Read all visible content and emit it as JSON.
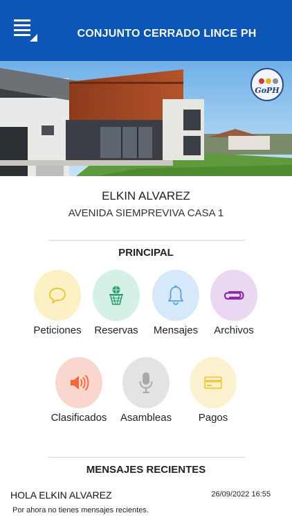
{
  "appbar": {
    "title": "CONJUNTO CERRADO LINCE PH",
    "color": "#0a55b5",
    "menu_icon": "menu-icon"
  },
  "hero": {
    "logo_text": "GoPH"
  },
  "user": {
    "name": "ELKIN ALVAREZ",
    "address": "AVENIDA SIEMPREVIVA CASA 1"
  },
  "principal": {
    "title": "PRINCIPAL",
    "tiles": [
      {
        "label": "Peticiones",
        "icon": "chat-bubble-icon",
        "bg": "#fbf1c4",
        "fg": "#e8c22a"
      },
      {
        "label": "Reservas",
        "icon": "basketball-hoop-icon",
        "bg": "#d5f0e4",
        "fg": "#2e9d6e"
      },
      {
        "label": "Mensajes",
        "icon": "bell-icon",
        "bg": "#d6e9fa",
        "fg": "#5f9fe0"
      },
      {
        "label": "Archivos",
        "icon": "paperclip-icon",
        "bg": "#ead7f1",
        "fg": "#8b2a9e"
      },
      {
        "label": "Clasificados",
        "icon": "megaphone-icon",
        "bg": "#fad6cf",
        "fg": "#f06a3b"
      },
      {
        "label": "Asambleas",
        "icon": "microphone-icon",
        "bg": "#e3e3e3",
        "fg": "#a9a9a9"
      },
      {
        "label": "Pagos",
        "icon": "credit-card-icon",
        "bg": "#fbf1cf",
        "fg": "#f0c93c"
      }
    ]
  },
  "recent": {
    "title": "MENSAJES RECIENTES",
    "message_title": "HOLA ELKIN ALVAREZ",
    "message_date": "26/09/2022 16:55",
    "message_body": "Por ahora no tienes mensajes recientes."
  }
}
